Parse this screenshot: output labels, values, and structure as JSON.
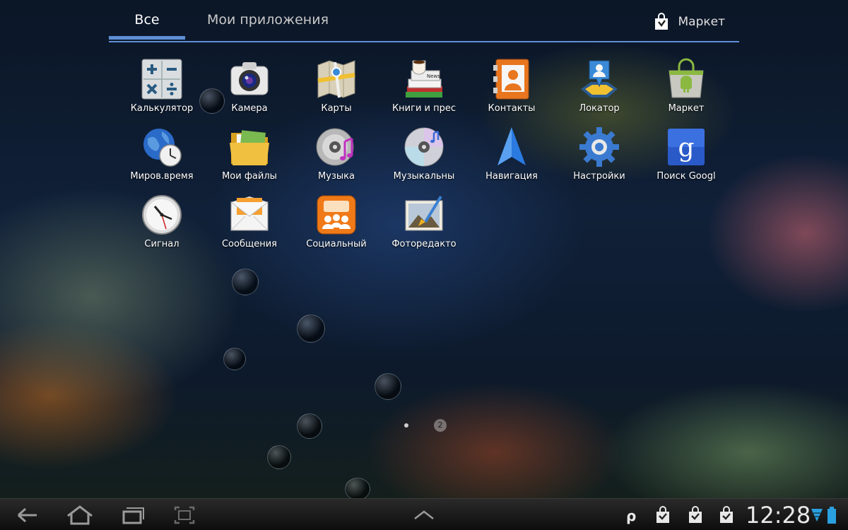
{
  "tabs": {
    "all_label": "Все",
    "my_apps_label": "Мои приложения"
  },
  "market_link": {
    "label": "Маркет",
    "icon": "market-bag-icon"
  },
  "apps": [
    {
      "label": "Калькулятор",
      "icon": "calculator-icon"
    },
    {
      "label": "Камера",
      "icon": "camera-icon"
    },
    {
      "label": "Карты",
      "icon": "maps-icon"
    },
    {
      "label": "Книги и прес",
      "icon": "books-press-icon"
    },
    {
      "label": "Контакты",
      "icon": "contacts-icon"
    },
    {
      "label": "Локатор",
      "icon": "locator-icon"
    },
    {
      "label": "Маркет",
      "icon": "market-icon"
    },
    {
      "label": "Миров.время",
      "icon": "world-clock-icon"
    },
    {
      "label": "Мои файлы",
      "icon": "folder-icon"
    },
    {
      "label": "Музыка",
      "icon": "music-icon"
    },
    {
      "label": "Музыкальны",
      "icon": "music-disc-icon"
    },
    {
      "label": "Навигация",
      "icon": "navigation-arrow-icon"
    },
    {
      "label": "Настройки",
      "icon": "settings-gear-icon"
    },
    {
      "label": "Поиск Googl",
      "icon": "google-search-icon"
    },
    {
      "label": "Сигнал",
      "icon": "alarm-clock-icon"
    },
    {
      "label": "Сообщения",
      "icon": "messages-envelope-icon"
    },
    {
      "label": "Социальный",
      "icon": "social-hub-icon"
    },
    {
      "label": "Фоторедакто",
      "icon": "photo-editor-icon"
    }
  ],
  "pager": {
    "current_page": 1,
    "total_pages": 2,
    "page_label": "2"
  },
  "status_bar": {
    "time": "12:28",
    "icons": [
      "p-indicator-icon",
      "market-notification-icon",
      "market-notification-icon",
      "market-notification-icon",
      "wifi-icon",
      "battery-icon"
    ]
  },
  "colors": {
    "accent": "#5d8fd6",
    "navbar": "#1a1a1a"
  }
}
